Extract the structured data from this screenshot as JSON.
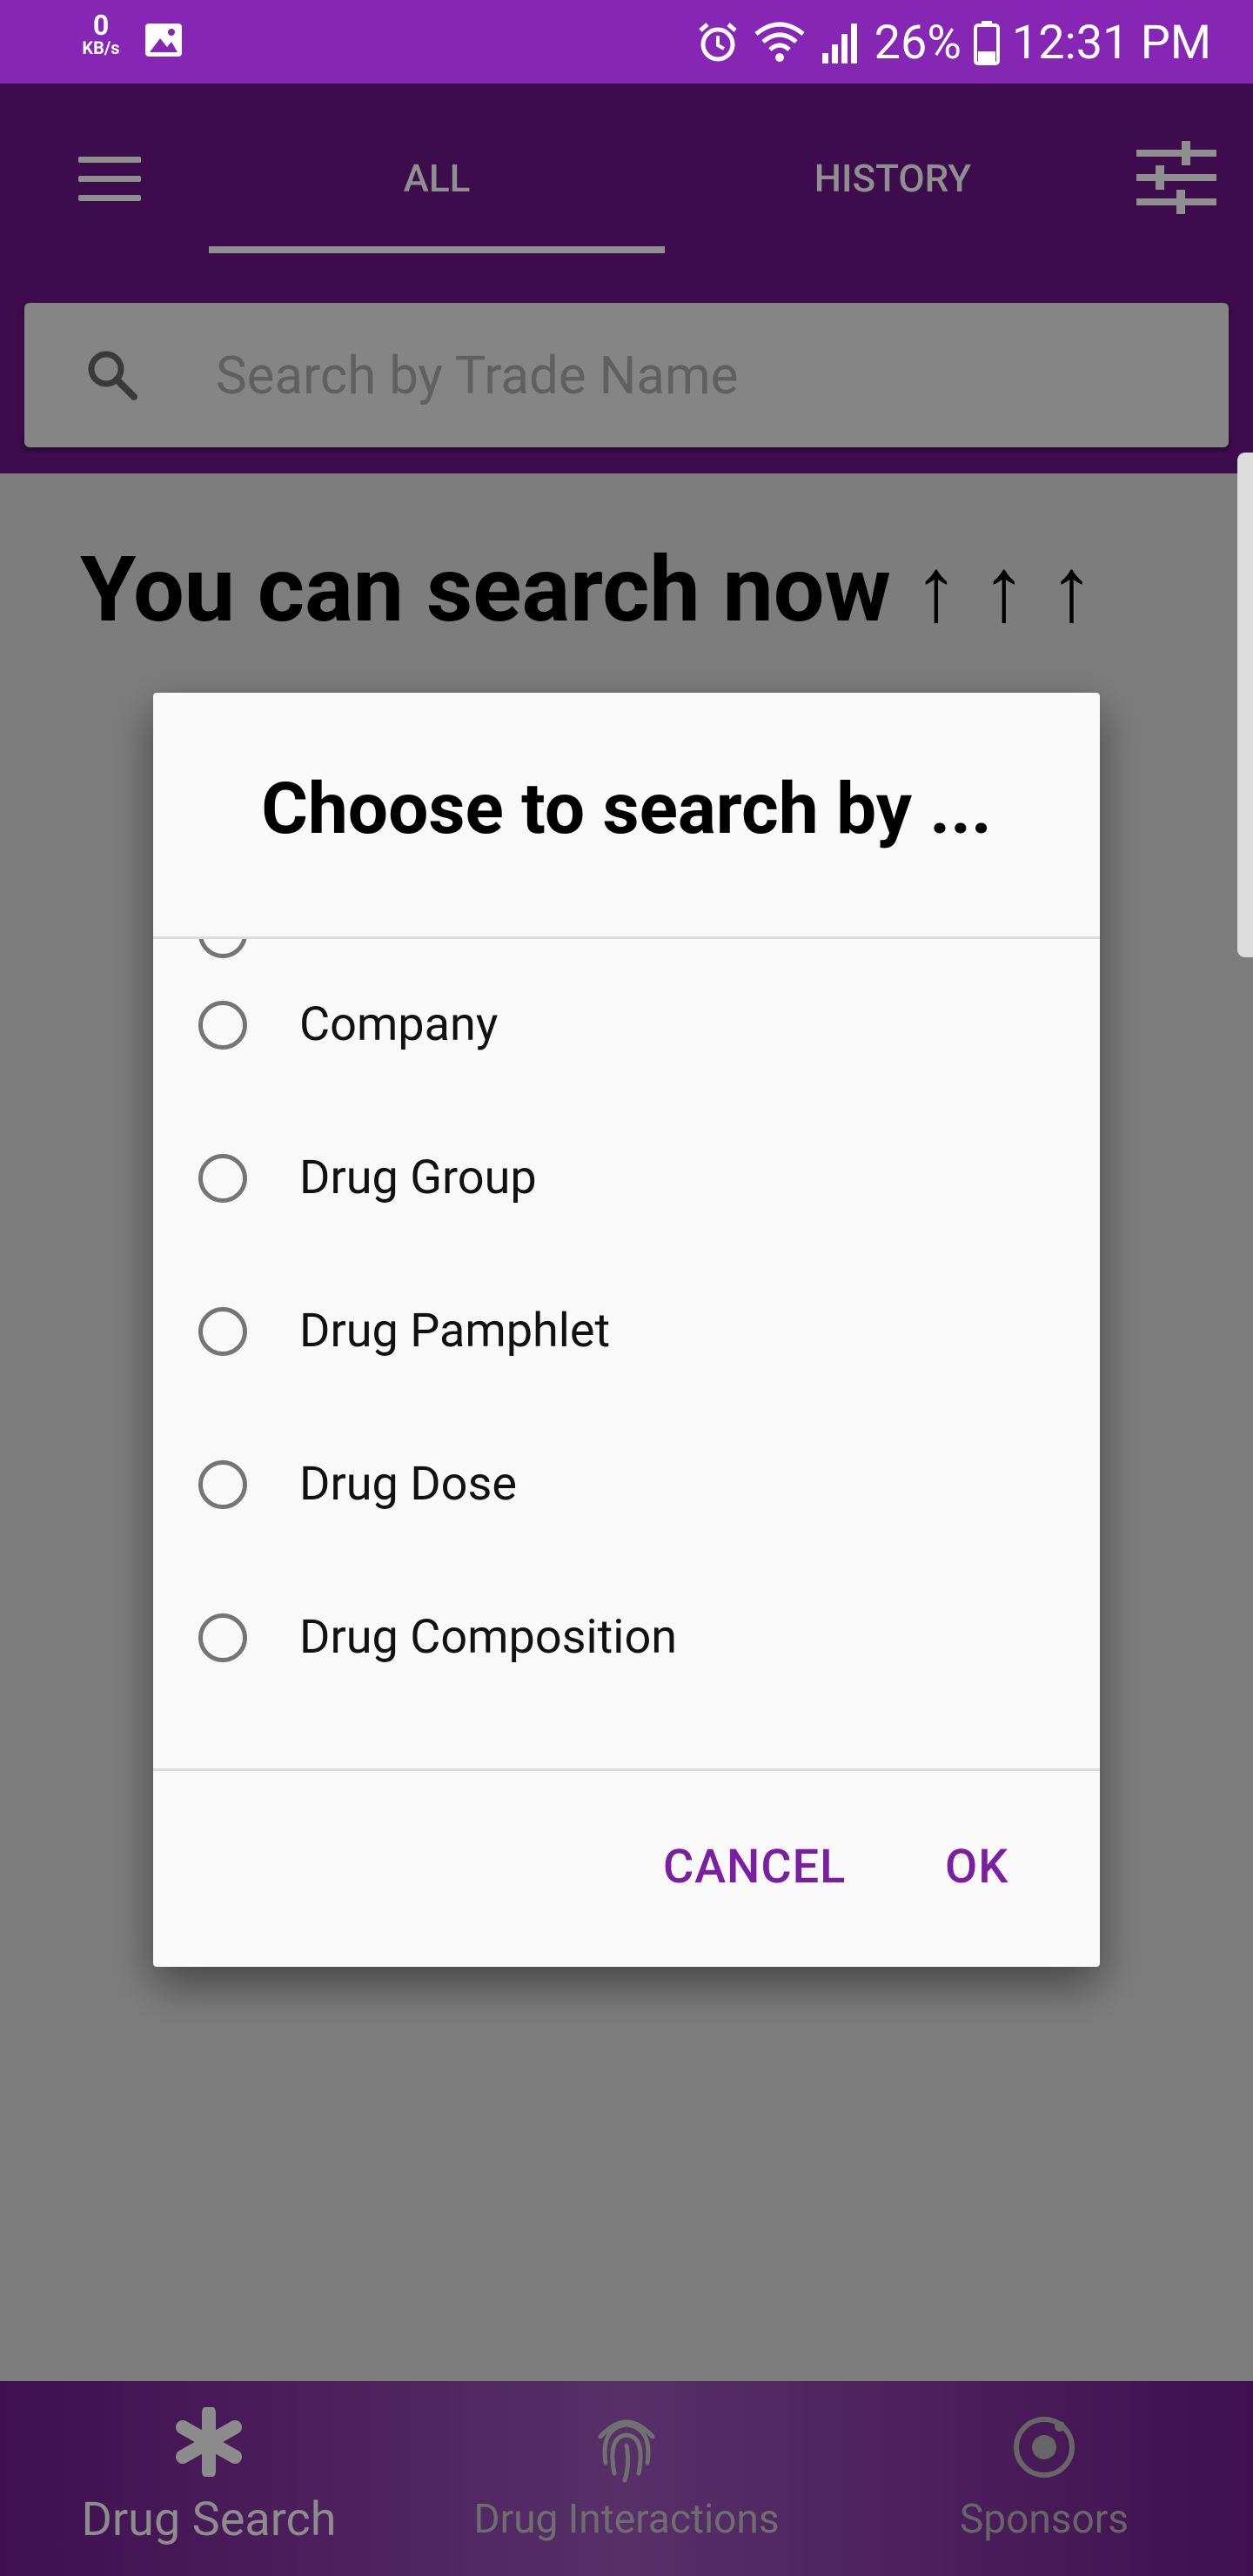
{
  "status_bar": {
    "net_speed_value": "0",
    "net_speed_unit": "KB/s",
    "battery": "26%",
    "time": "12:31 PM"
  },
  "app_bar": {
    "tabs": [
      {
        "label": "ALL",
        "selected": true
      },
      {
        "label": "HISTORY",
        "selected": false
      }
    ],
    "search_placeholder": "Search by Trade Name"
  },
  "content": {
    "headline": "You can search now ↑ ↑ ↑"
  },
  "dialog": {
    "title": "Choose to search by ...",
    "options": [
      {
        "label": "Company",
        "selected": false
      },
      {
        "label": "Drug Group",
        "selected": false
      },
      {
        "label": "Drug Pamphlet",
        "selected": false
      },
      {
        "label": "Drug Dose",
        "selected": false
      },
      {
        "label": "Drug Composition",
        "selected": false
      }
    ],
    "cancel_label": "CANCEL",
    "ok_label": "OK"
  },
  "bottom_nav": {
    "items": [
      {
        "label": "Drug Search",
        "icon": "asterisk-icon",
        "active": true
      },
      {
        "label": "Drug Interactions",
        "icon": "fingerprint-icon",
        "active": false
      },
      {
        "label": "Sponsors",
        "icon": "sponsor-circle-icon",
        "active": false
      }
    ]
  },
  "colors": {
    "status_bar": "#8526b4",
    "app_bar": "#3c0c4d",
    "accent": "#7b1fa2",
    "scrim": "#7d7d7d"
  }
}
